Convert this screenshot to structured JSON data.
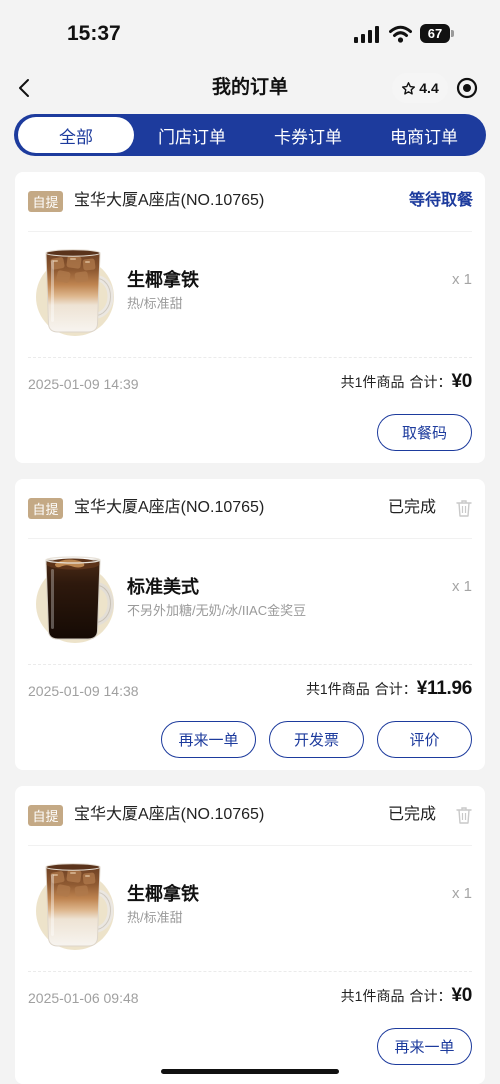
{
  "status_bar": {
    "time": "15:37",
    "battery": "67",
    "icons": [
      "signal-icon",
      "wifi-icon",
      "battery-icon"
    ]
  },
  "colors": {
    "primary": "#1d3b9d",
    "tag_bg": "#c4a985",
    "page_bg": "#f3f3f3",
    "muted_text": "#a0a0a0"
  },
  "header": {
    "title": "我的订单",
    "rating": "4.4",
    "icons": [
      "back-arrow-icon",
      "star-icon",
      "target-icon"
    ]
  },
  "tabs": [
    {
      "label": "全部",
      "active": true
    },
    {
      "label": "门店订单",
      "active": false
    },
    {
      "label": "卡券订单",
      "active": false
    },
    {
      "label": "电商订单",
      "active": false
    }
  ],
  "orders": [
    {
      "tag": "自提",
      "store": "宝华大厦A座店(NO.10765)",
      "status": "等待取餐",
      "item": {
        "name": "生椰拿铁",
        "options": "热/标准甜",
        "qty": "x 1",
        "image": "coconut-latte-image"
      },
      "time": "2025-01-09 14:39",
      "count": "共1件商品",
      "total_label": "合计：",
      "total": "¥0",
      "actions": [
        "取餐码"
      ]
    },
    {
      "tag": "自提",
      "store": "宝华大厦A座店(NO.10765)",
      "status": "已完成",
      "delete_icon": "trash-icon",
      "item": {
        "name": "标准美式",
        "options": "不另外加糖/无奶/冰/IIAC金奖豆",
        "qty": "x 1",
        "image": "americano-image"
      },
      "time": "2025-01-09 14:38",
      "count": "共1件商品",
      "total_label": "合计：",
      "total": "¥11.96",
      "actions": [
        "再来一单",
        "开发票",
        "评价"
      ]
    },
    {
      "tag": "自提",
      "store": "宝华大厦A座店(NO.10765)",
      "status": "已完成",
      "delete_icon": "trash-icon",
      "item": {
        "name": "生椰拿铁",
        "options": "热/标准甜",
        "qty": "x 1",
        "image": "coconut-latte-image"
      },
      "time": "2025-01-06 09:48",
      "count": "共1件商品",
      "total_label": "合计：",
      "total": "¥0",
      "actions": [
        "再来一单"
      ]
    }
  ]
}
